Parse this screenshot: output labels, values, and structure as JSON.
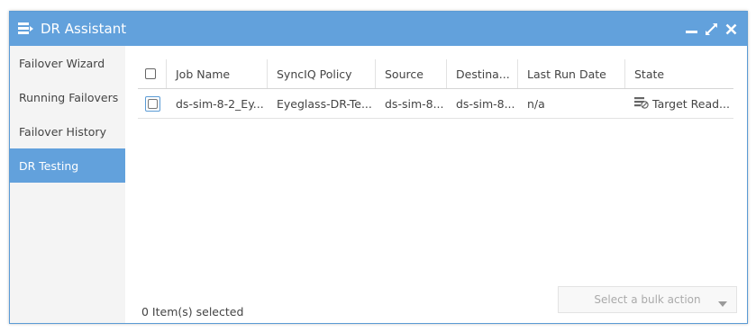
{
  "window": {
    "title": "DR Assistant"
  },
  "sidebar": {
    "items": [
      {
        "label": "Failover Wizard"
      },
      {
        "label": "Running Failovers"
      },
      {
        "label": "Failover History"
      },
      {
        "label": "DR Testing"
      }
    ],
    "active_index": 3
  },
  "table": {
    "columns": [
      "Job Name",
      "SyncIQ Policy",
      "Source",
      "Destina...",
      "Last Run Date",
      "State"
    ],
    "rows": [
      {
        "job_name": "ds-sim-8-2_Ey...",
        "policy": "Eyeglass-DR-Te...",
        "source": "ds-sim-8...",
        "destination": "ds-sim-8...",
        "last_run": "n/a",
        "state": "Target Read...",
        "state_icon": "target-ready-icon",
        "selected": false
      }
    ]
  },
  "footer": {
    "selection_count": "0 Item(s) selected",
    "bulk_action_placeholder": "Select a bulk action"
  },
  "colors": {
    "accent": "#62a1dc",
    "sidebar_bg": "#f4f4f4"
  }
}
